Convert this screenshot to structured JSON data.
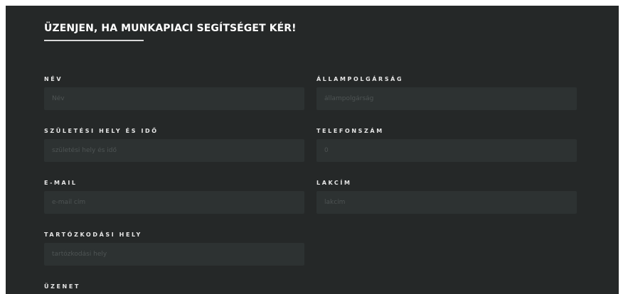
{
  "form": {
    "title": "ÜZENJEN, HA MUNKAPIACI SEGÍTSÉGET KÉR!",
    "fields": {
      "nev": {
        "label": "NÉV",
        "placeholder": "Név"
      },
      "allampolgarsag": {
        "label": "ÁLLAMPOLGÁRSÁG",
        "placeholder": "állampolgárság"
      },
      "szuletesi": {
        "label": "SZÜLETÉSI HELY ÉS IDŐ",
        "placeholder": "születési hely és idő"
      },
      "telefon": {
        "label": "TELEFONSZÁM",
        "placeholder": "0"
      },
      "email": {
        "label": "E-MAIL",
        "placeholder": "e-mail cím"
      },
      "lakcim": {
        "label": "LAKCÍM",
        "placeholder": "lakcím"
      },
      "tartozkodasi": {
        "label": "TARTÓZKODÁSI HELY",
        "placeholder": "tartózkodási hely"
      },
      "uzenet": {
        "label": "ÜZENET"
      }
    }
  }
}
